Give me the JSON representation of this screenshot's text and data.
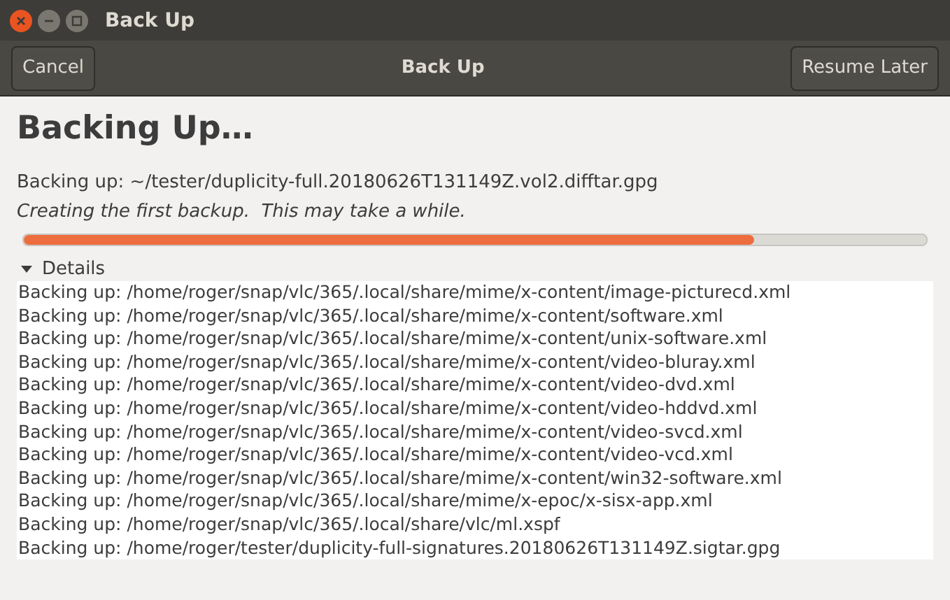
{
  "window": {
    "title": "Back Up"
  },
  "header_bar": {
    "cancel_button": "Cancel",
    "title": "Back Up",
    "resume_button": "Resume Later"
  },
  "heading": "Backing Up…",
  "current_file": "Backing up: ~/tester/duplicity-full.20180626T131149Z.vol2.difftar.gpg",
  "status": "Creating the first backup.  This may take a while.",
  "progress": {
    "level": 0.81
  },
  "details": {
    "label": "Details",
    "expanded": true,
    "lines": [
      "Backing up: /home/roger/snap/vlc/365/.local/share/mime/x-content/image-picturecd.xml",
      "Backing up: /home/roger/snap/vlc/365/.local/share/mime/x-content/software.xml",
      "Backing up: /home/roger/snap/vlc/365/.local/share/mime/x-content/unix-software.xml",
      "Backing up: /home/roger/snap/vlc/365/.local/share/mime/x-content/video-bluray.xml",
      "Backing up: /home/roger/snap/vlc/365/.local/share/mime/x-content/video-dvd.xml",
      "Backing up: /home/roger/snap/vlc/365/.local/share/mime/x-content/video-hddvd.xml",
      "Backing up: /home/roger/snap/vlc/365/.local/share/mime/x-content/video-svcd.xml",
      "Backing up: /home/roger/snap/vlc/365/.local/share/mime/x-content/video-vcd.xml",
      "Backing up: /home/roger/snap/vlc/365/.local/share/mime/x-content/win32-software.xml",
      "Backing up: /home/roger/snap/vlc/365/.local/share/mime/x-epoc/x-sisx-app.xml",
      "Backing up: /home/roger/snap/vlc/365/.local/share/vlc/ml.xspf",
      "Backing up: /home/roger/tester/duplicity-full-signatures.20180626T131149Z.sigtar.gpg"
    ]
  }
}
